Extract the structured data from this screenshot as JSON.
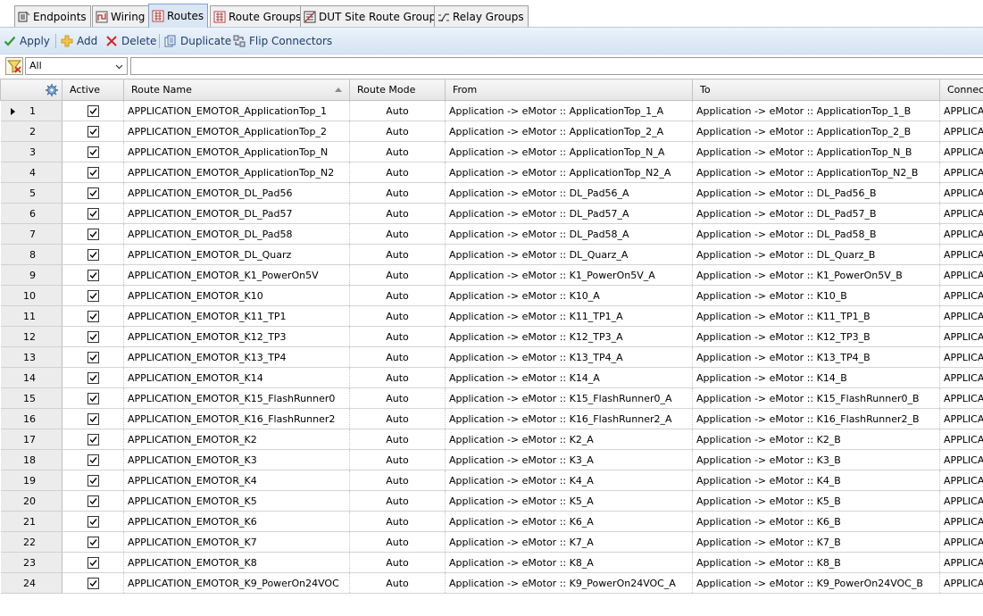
{
  "tabs": [
    {
      "label": "Endpoints",
      "icon": "endpoints-icon",
      "active": false
    },
    {
      "label": "Wiring",
      "icon": "wiring-icon",
      "active": false
    },
    {
      "label": "Routes",
      "icon": "routes-icon",
      "active": true
    },
    {
      "label": "Route Groups",
      "icon": "route-groups-icon",
      "active": false
    },
    {
      "label": "DUT Site Route Groups",
      "icon": "dut-site-route-groups-icon",
      "active": false
    },
    {
      "label": "Relay Groups",
      "icon": "relay-groups-icon",
      "active": false
    }
  ],
  "toolbar": {
    "apply_label": "Apply",
    "add_label": "Add",
    "delete_label": "Delete",
    "duplicate_label": "Duplicate",
    "flip_label": "Flip Connectors"
  },
  "filter": {
    "selected": "All",
    "text": ""
  },
  "grid": {
    "columns": {
      "active": "Active",
      "route_name": "Route Name",
      "route_mode": "Route Mode",
      "from": "From",
      "to": "To",
      "connect": "Connect"
    },
    "rows": [
      {
        "num": "1",
        "name": "APPLICATION_EMOTOR_ApplicationTop_1",
        "mode": "Auto",
        "from": "Application -> eMotor :: ApplicationTop_1_A",
        "to": "Application -> eMotor :: ApplicationTop_1_B",
        "connect": "APPLICAT"
      },
      {
        "num": "2",
        "name": "APPLICATION_EMOTOR_ApplicationTop_2",
        "mode": "Auto",
        "from": "Application -> eMotor :: ApplicationTop_2_A",
        "to": "Application -> eMotor :: ApplicationTop_2_B",
        "connect": "APPLICAT"
      },
      {
        "num": "3",
        "name": "APPLICATION_EMOTOR_ApplicationTop_N",
        "mode": "Auto",
        "from": "Application -> eMotor :: ApplicationTop_N_A",
        "to": "Application -> eMotor :: ApplicationTop_N_B",
        "connect": "APPLICAT"
      },
      {
        "num": "4",
        "name": "APPLICATION_EMOTOR_ApplicationTop_N2",
        "mode": "Auto",
        "from": "Application -> eMotor :: ApplicationTop_N2_A",
        "to": "Application -> eMotor :: ApplicationTop_N2_B",
        "connect": "APPLICAT"
      },
      {
        "num": "5",
        "name": "APPLICATION_EMOTOR_DL_Pad56",
        "mode": "Auto",
        "from": "Application -> eMotor :: DL_Pad56_A",
        "to": "Application -> eMotor :: DL_Pad56_B",
        "connect": "APPLICAT"
      },
      {
        "num": "6",
        "name": "APPLICATION_EMOTOR_DL_Pad57",
        "mode": "Auto",
        "from": "Application -> eMotor :: DL_Pad57_A",
        "to": "Application -> eMotor :: DL_Pad57_B",
        "connect": "APPLICAT"
      },
      {
        "num": "7",
        "name": "APPLICATION_EMOTOR_DL_Pad58",
        "mode": "Auto",
        "from": "Application -> eMotor :: DL_Pad58_A",
        "to": "Application -> eMotor :: DL_Pad58_B",
        "connect": "APPLICAT"
      },
      {
        "num": "8",
        "name": "APPLICATION_EMOTOR_DL_Quarz",
        "mode": "Auto",
        "from": "Application -> eMotor :: DL_Quarz_A",
        "to": "Application -> eMotor :: DL_Quarz_B",
        "connect": "APPLICAT"
      },
      {
        "num": "9",
        "name": "APPLICATION_EMOTOR_K1_PowerOn5V",
        "mode": "Auto",
        "from": "Application -> eMotor :: K1_PowerOn5V_A",
        "to": "Application -> eMotor :: K1_PowerOn5V_B",
        "connect": "APPLICAT"
      },
      {
        "num": "10",
        "name": "APPLICATION_EMOTOR_K10",
        "mode": "Auto",
        "from": "Application -> eMotor :: K10_A",
        "to": "Application -> eMotor :: K10_B",
        "connect": "APPLICAT"
      },
      {
        "num": "11",
        "name": "APPLICATION_EMOTOR_K11_TP1",
        "mode": "Auto",
        "from": "Application -> eMotor :: K11_TP1_A",
        "to": "Application -> eMotor :: K11_TP1_B",
        "connect": "APPLICAT"
      },
      {
        "num": "12",
        "name": "APPLICATION_EMOTOR_K12_TP3",
        "mode": "Auto",
        "from": "Application -> eMotor :: K12_TP3_A",
        "to": "Application -> eMotor :: K12_TP3_B",
        "connect": "APPLICAT"
      },
      {
        "num": "13",
        "name": "APPLICATION_EMOTOR_K13_TP4",
        "mode": "Auto",
        "from": "Application -> eMotor :: K13_TP4_A",
        "to": "Application -> eMotor :: K13_TP4_B",
        "connect": "APPLICAT"
      },
      {
        "num": "14",
        "name": "APPLICATION_EMOTOR_K14",
        "mode": "Auto",
        "from": "Application -> eMotor :: K14_A",
        "to": "Application -> eMotor :: K14_B",
        "connect": "APPLICAT"
      },
      {
        "num": "15",
        "name": "APPLICATION_EMOTOR_K15_FlashRunner0",
        "mode": "Auto",
        "from": "Application -> eMotor :: K15_FlashRunner0_A",
        "to": "Application -> eMotor :: K15_FlashRunner0_B",
        "connect": "APPLICAT"
      },
      {
        "num": "16",
        "name": "APPLICATION_EMOTOR_K16_FlashRunner2",
        "mode": "Auto",
        "from": "Application -> eMotor :: K16_FlashRunner2_A",
        "to": "Application -> eMotor :: K16_FlashRunner2_B",
        "connect": "APPLICAT"
      },
      {
        "num": "17",
        "name": "APPLICATION_EMOTOR_K2",
        "mode": "Auto",
        "from": "Application -> eMotor :: K2_A",
        "to": "Application -> eMotor :: K2_B",
        "connect": "APPLICAT"
      },
      {
        "num": "18",
        "name": "APPLICATION_EMOTOR_K3",
        "mode": "Auto",
        "from": "Application -> eMotor :: K3_A",
        "to": "Application -> eMotor :: K3_B",
        "connect": "APPLICAT"
      },
      {
        "num": "19",
        "name": "APPLICATION_EMOTOR_K4",
        "mode": "Auto",
        "from": "Application -> eMotor :: K4_A",
        "to": "Application -> eMotor :: K4_B",
        "connect": "APPLICAT"
      },
      {
        "num": "20",
        "name": "APPLICATION_EMOTOR_K5",
        "mode": "Auto",
        "from": "Application -> eMotor :: K5_A",
        "to": "Application -> eMotor :: K5_B",
        "connect": "APPLICAT"
      },
      {
        "num": "21",
        "name": "APPLICATION_EMOTOR_K6",
        "mode": "Auto",
        "from": "Application -> eMotor :: K6_A",
        "to": "Application -> eMotor :: K6_B",
        "connect": "APPLICAT"
      },
      {
        "num": "22",
        "name": "APPLICATION_EMOTOR_K7",
        "mode": "Auto",
        "from": "Application -> eMotor :: K7_A",
        "to": "Application -> eMotor :: K7_B",
        "connect": "APPLICAT"
      },
      {
        "num": "23",
        "name": "APPLICATION_EMOTOR_K8",
        "mode": "Auto",
        "from": "Application -> eMotor :: K8_A",
        "to": "Application -> eMotor :: K8_B",
        "connect": "APPLICAT"
      },
      {
        "num": "24",
        "name": "APPLICATION_EMOTOR_K9_PowerOn24VOC",
        "mode": "Auto",
        "from": "Application -> eMotor :: K9_PowerOn24VOC_A",
        "to": "Application -> eMotor :: K9_PowerOn24VOC_B",
        "connect": "APPLICAT"
      }
    ]
  },
  "colors": {
    "active_tab": "#dae6f3",
    "toolbar_text": "#1f3b6e",
    "apply_green": "#2e9b2e",
    "delete_red": "#d42020",
    "add_orange": "#e8a317"
  }
}
